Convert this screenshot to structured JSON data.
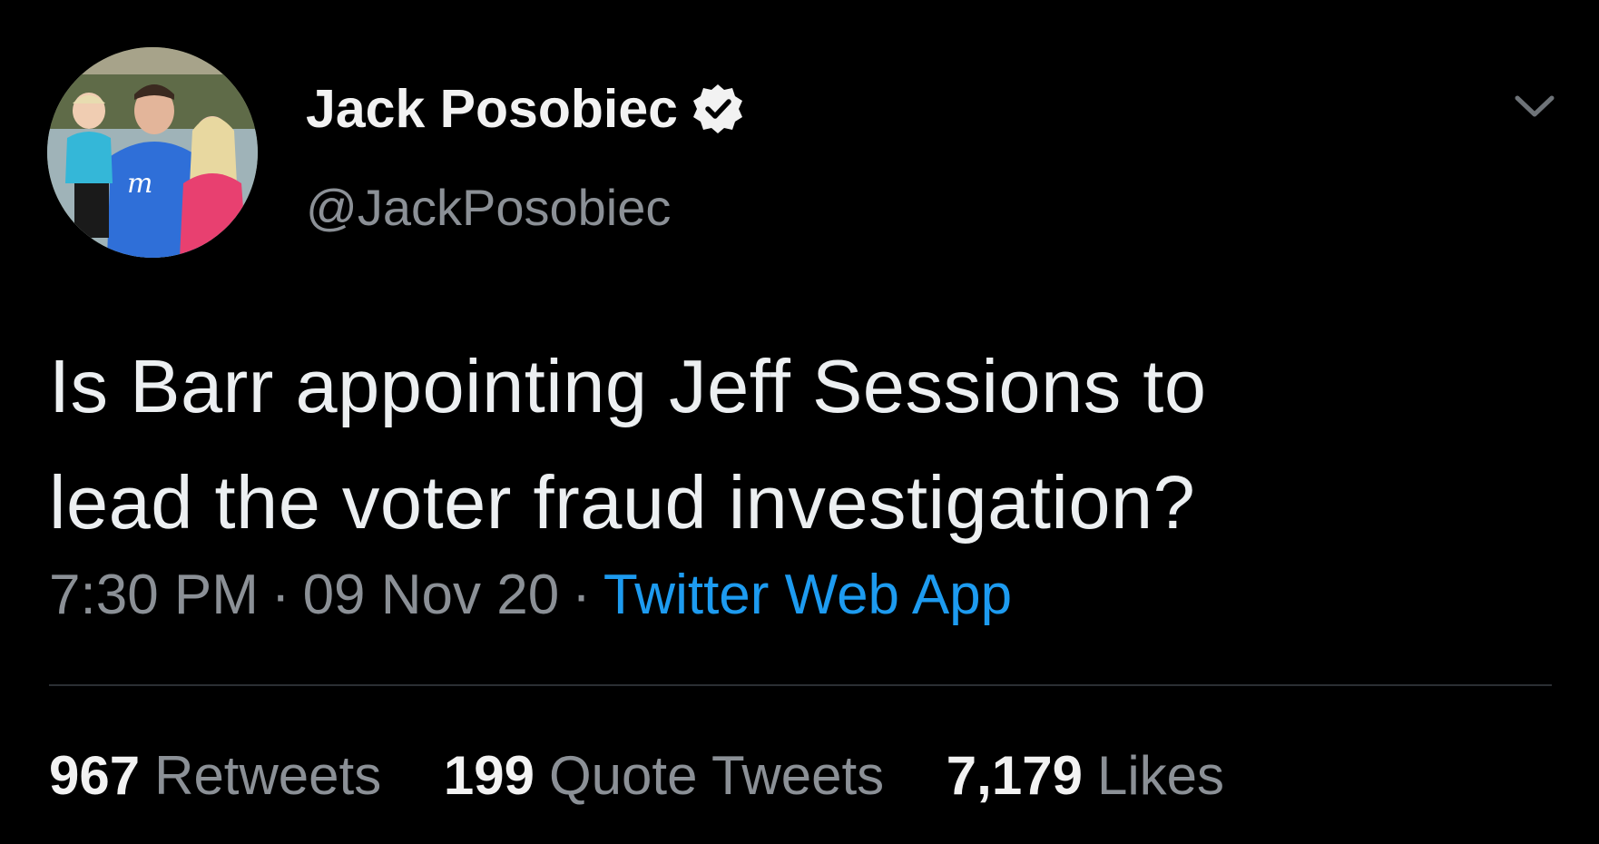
{
  "tweet": {
    "display_name": "Jack Posobiec",
    "handle": "@JackPosobiec",
    "verified": true,
    "text_lines": [
      "Is Barr appointing Jeff Sessions to",
      "lead the voter fraud investigation?"
    ],
    "time": "7:30 PM",
    "date": "09 Nov 20",
    "separator": "·",
    "source": "Twitter Web App",
    "stats": {
      "retweets": {
        "count": "967",
        "label": "Retweets"
      },
      "quote_tweets": {
        "count": "199",
        "label": "Quote Tweets"
      },
      "likes": {
        "count": "7,179",
        "label": "Likes"
      }
    }
  },
  "icons": {
    "verified": "verified-badge-icon",
    "more": "chevron-down-icon",
    "avatar": "profile-photo"
  },
  "colors": {
    "background": "#000000",
    "text": "#eceff1",
    "muted": "#8b9096",
    "link": "#1d9bf0",
    "divider": "#2b2f33"
  }
}
